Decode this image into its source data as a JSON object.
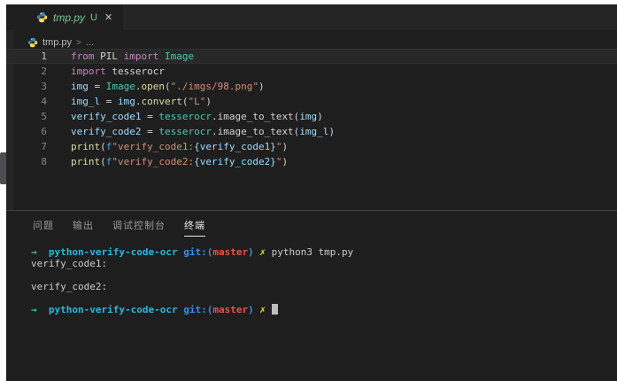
{
  "tab": {
    "file_name": "tmp.py",
    "git_badge": "U",
    "close_label": "✕"
  },
  "breadcrumb": {
    "file_name": "tmp.py",
    "separator": ">",
    "ellipsis": "..."
  },
  "editor": {
    "active_line": "1",
    "lines": [
      {
        "num": "1",
        "segments": [
          [
            "kw",
            "from"
          ],
          [
            "plain",
            " PIL "
          ],
          [
            "kw",
            "import"
          ],
          [
            "plain",
            " "
          ],
          [
            "cls",
            "Image"
          ]
        ]
      },
      {
        "num": "2",
        "segments": [
          [
            "kw",
            "import"
          ],
          [
            "plain",
            " tesserocr"
          ]
        ]
      },
      {
        "num": "3",
        "segments": [
          [
            "var",
            "img"
          ],
          [
            "plain",
            " = "
          ],
          [
            "cls",
            "Image"
          ],
          [
            "plain",
            "."
          ],
          [
            "fn",
            "open"
          ],
          [
            "plain",
            "("
          ],
          [
            "str",
            "\"./imgs/98.png\""
          ],
          [
            "plain",
            ")"
          ]
        ]
      },
      {
        "num": "4",
        "segments": [
          [
            "var",
            "img_l"
          ],
          [
            "plain",
            " = "
          ],
          [
            "var",
            "img"
          ],
          [
            "plain",
            "."
          ],
          [
            "fn",
            "convert"
          ],
          [
            "plain",
            "("
          ],
          [
            "str",
            "\"L\""
          ],
          [
            "plain",
            ")"
          ]
        ]
      },
      {
        "num": "5",
        "segments": [
          [
            "var",
            "verify_code1"
          ],
          [
            "plain",
            " = "
          ],
          [
            "cls",
            "tesserocr"
          ],
          [
            "plain",
            ".image_to_text("
          ],
          [
            "var",
            "img"
          ],
          [
            "plain",
            ")"
          ]
        ]
      },
      {
        "num": "6",
        "segments": [
          [
            "var",
            "verify_code2"
          ],
          [
            "plain",
            " = "
          ],
          [
            "cls",
            "tesserocr"
          ],
          [
            "plain",
            ".image_to_text("
          ],
          [
            "var",
            "img_l"
          ],
          [
            "plain",
            ")"
          ]
        ]
      },
      {
        "num": "7",
        "segments": [
          [
            "fn",
            "print"
          ],
          [
            "plain",
            "("
          ],
          [
            "kw2",
            "f"
          ],
          [
            "str",
            "\"verify_code1:"
          ],
          [
            "var",
            "{verify_code1}"
          ],
          [
            "str",
            "\""
          ],
          [
            "plain",
            ")"
          ]
        ]
      },
      {
        "num": "8",
        "segments": [
          [
            "fn",
            "print"
          ],
          [
            "plain",
            "("
          ],
          [
            "kw2",
            "f"
          ],
          [
            "str",
            "\"verify_code2:"
          ],
          [
            "var",
            "{verify_code2}"
          ],
          [
            "str",
            "\""
          ],
          [
            "plain",
            ")"
          ]
        ]
      }
    ]
  },
  "panel": {
    "tabs": [
      {
        "label": "问题",
        "active": false
      },
      {
        "label": "输出",
        "active": false
      },
      {
        "label": "调试控制台",
        "active": false
      },
      {
        "label": "终端",
        "active": true
      }
    ]
  },
  "terminal": {
    "lines": [
      {
        "segments": [
          [
            "arrow",
            "→"
          ],
          [
            "plain",
            "  "
          ],
          [
            "dir",
            "python-verify-code-ocr"
          ],
          [
            "plain",
            " "
          ],
          [
            "git",
            "git:("
          ],
          [
            "branch",
            "master"
          ],
          [
            "git",
            ")"
          ],
          [
            "plain",
            " "
          ],
          [
            "err",
            "✗"
          ],
          [
            "plain",
            " "
          ],
          [
            "plain",
            "python3 tmp.py"
          ]
        ]
      },
      {
        "segments": [
          [
            "plain",
            "verify_code1:"
          ]
        ]
      },
      {
        "segments": []
      },
      {
        "segments": [
          [
            "plain",
            "verify_code2:"
          ]
        ]
      },
      {
        "segments": []
      },
      {
        "segments": [
          [
            "arrow",
            "→"
          ],
          [
            "plain",
            "  "
          ],
          [
            "dir",
            "python-verify-code-ocr"
          ],
          [
            "plain",
            " "
          ],
          [
            "git",
            "git:("
          ],
          [
            "branch",
            "master"
          ],
          [
            "git",
            ")"
          ],
          [
            "plain",
            " "
          ],
          [
            "err",
            "✗"
          ],
          [
            "plain",
            " "
          ],
          [
            "cursor",
            " "
          ]
        ]
      }
    ]
  },
  "colors": {
    "tab_green": "#73c991",
    "kw": "#c586c0",
    "kw2": "#569cd6",
    "cls": "#4ec9b0",
    "fn": "#dcdcaa",
    "var": "#9cdcfe",
    "str": "#ce9178",
    "plain": "#d4d4d4",
    "term_green": "#23d18b",
    "term_cyan": "#29b8db",
    "term_blue": "#3b8eea",
    "term_red": "#f14c4c",
    "term_yellow": "#e5e510",
    "term_fg": "#cccccc"
  }
}
